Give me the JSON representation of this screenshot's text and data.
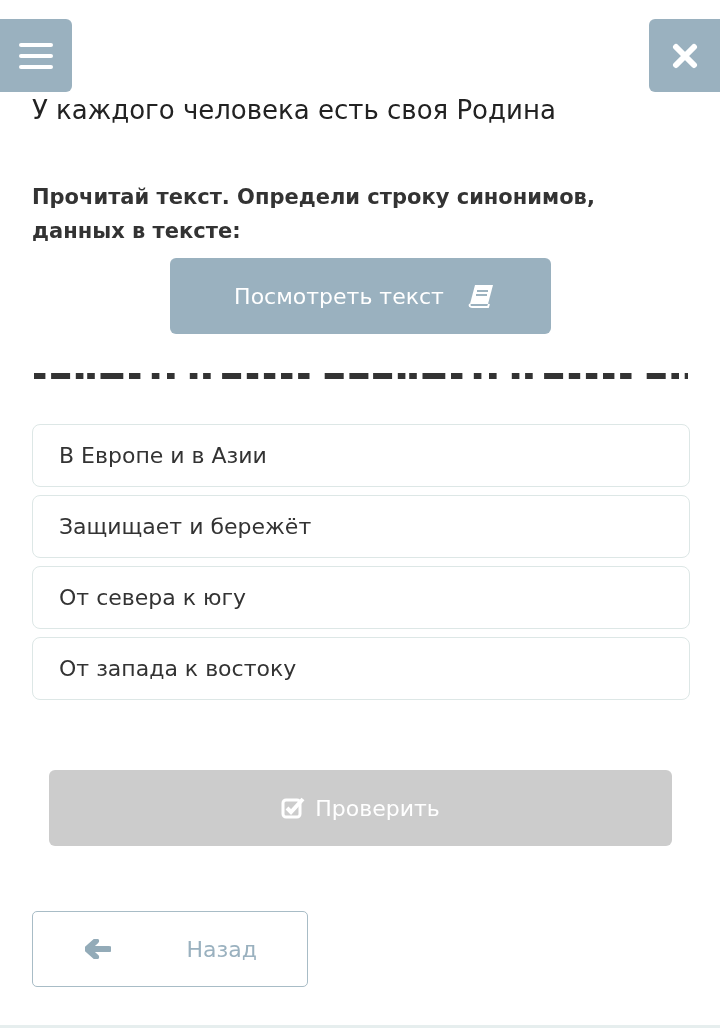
{
  "title": "У каждого человека есть своя Родина",
  "instruction": "Прочитай текст. Определи строку синонимов, данных в тексте:",
  "view_text_button": {
    "label": "Посмотреть текст"
  },
  "options": [
    {
      "label": "В Европе и в Азии",
      "selected": false
    },
    {
      "label": "Защищает и бережёт",
      "selected": false
    },
    {
      "label": "От севера к югу",
      "selected": false
    },
    {
      "label": "От запада к востоку",
      "selected": false
    }
  ],
  "check_button": {
    "label": "Проверить",
    "disabled": true
  },
  "back_button": {
    "label": "Назад"
  }
}
